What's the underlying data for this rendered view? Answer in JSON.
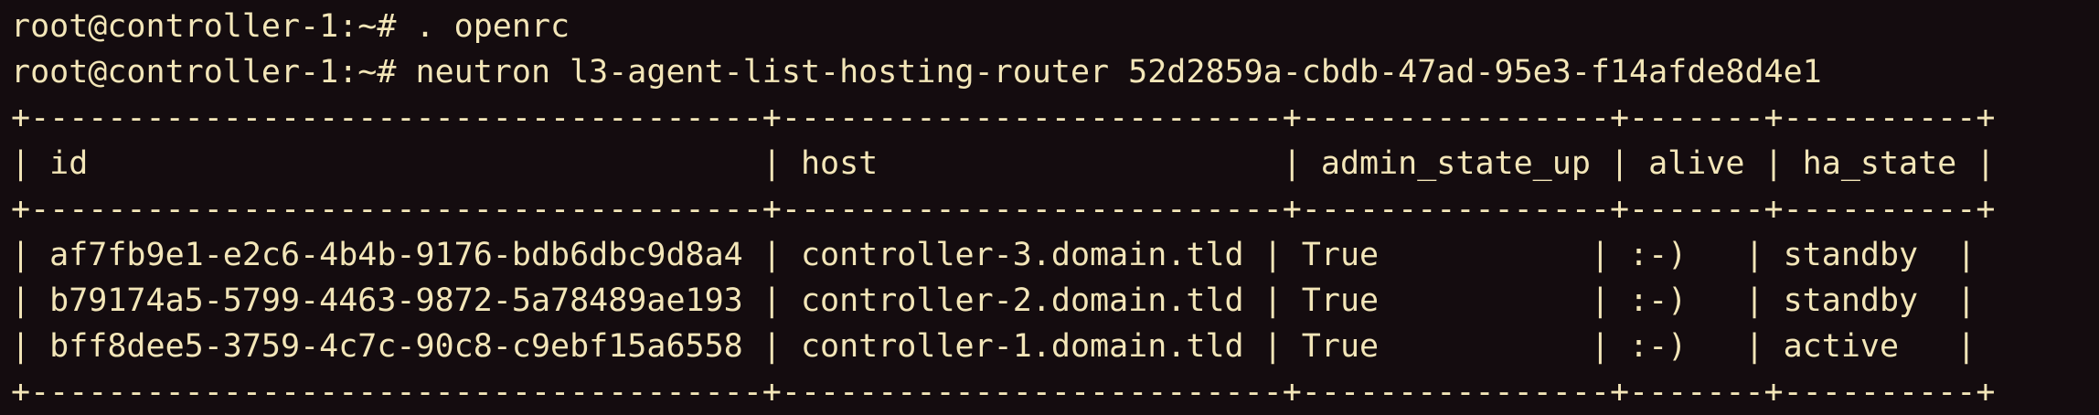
{
  "terminal": {
    "lines": [
      "root@controller-1:~# . openrc",
      "root@controller-1:~# neutron l3-agent-list-hosting-router 52d2859a-cbdb-47ad-95e3-f14afde8d4e1",
      "+--------------------------------------+--------------------------+----------------+-------+----------+",
      "| id                                   | host                     | admin_state_up | alive | ha_state |",
      "+--------------------------------------+--------------------------+----------------+-------+----------+",
      "| af7fb9e1-e2c6-4b4b-9176-bdb6dbc9d8a4 | controller-3.domain.tld | True           | :-)   | standby  |",
      "| b79174a5-5799-4463-9872-5a78489ae193 | controller-2.domain.tld | True           | :-)   | standby  |",
      "| bff8dee5-3759-4c7c-90c8-c9ebf15a6558 | controller-1.domain.tld | True           | :-)   | active   |",
      "+--------------------------------------+--------------------------+----------------+-------+----------+"
    ]
  },
  "colors": {
    "background": "#140c0f",
    "text": "#f3e6b8"
  }
}
